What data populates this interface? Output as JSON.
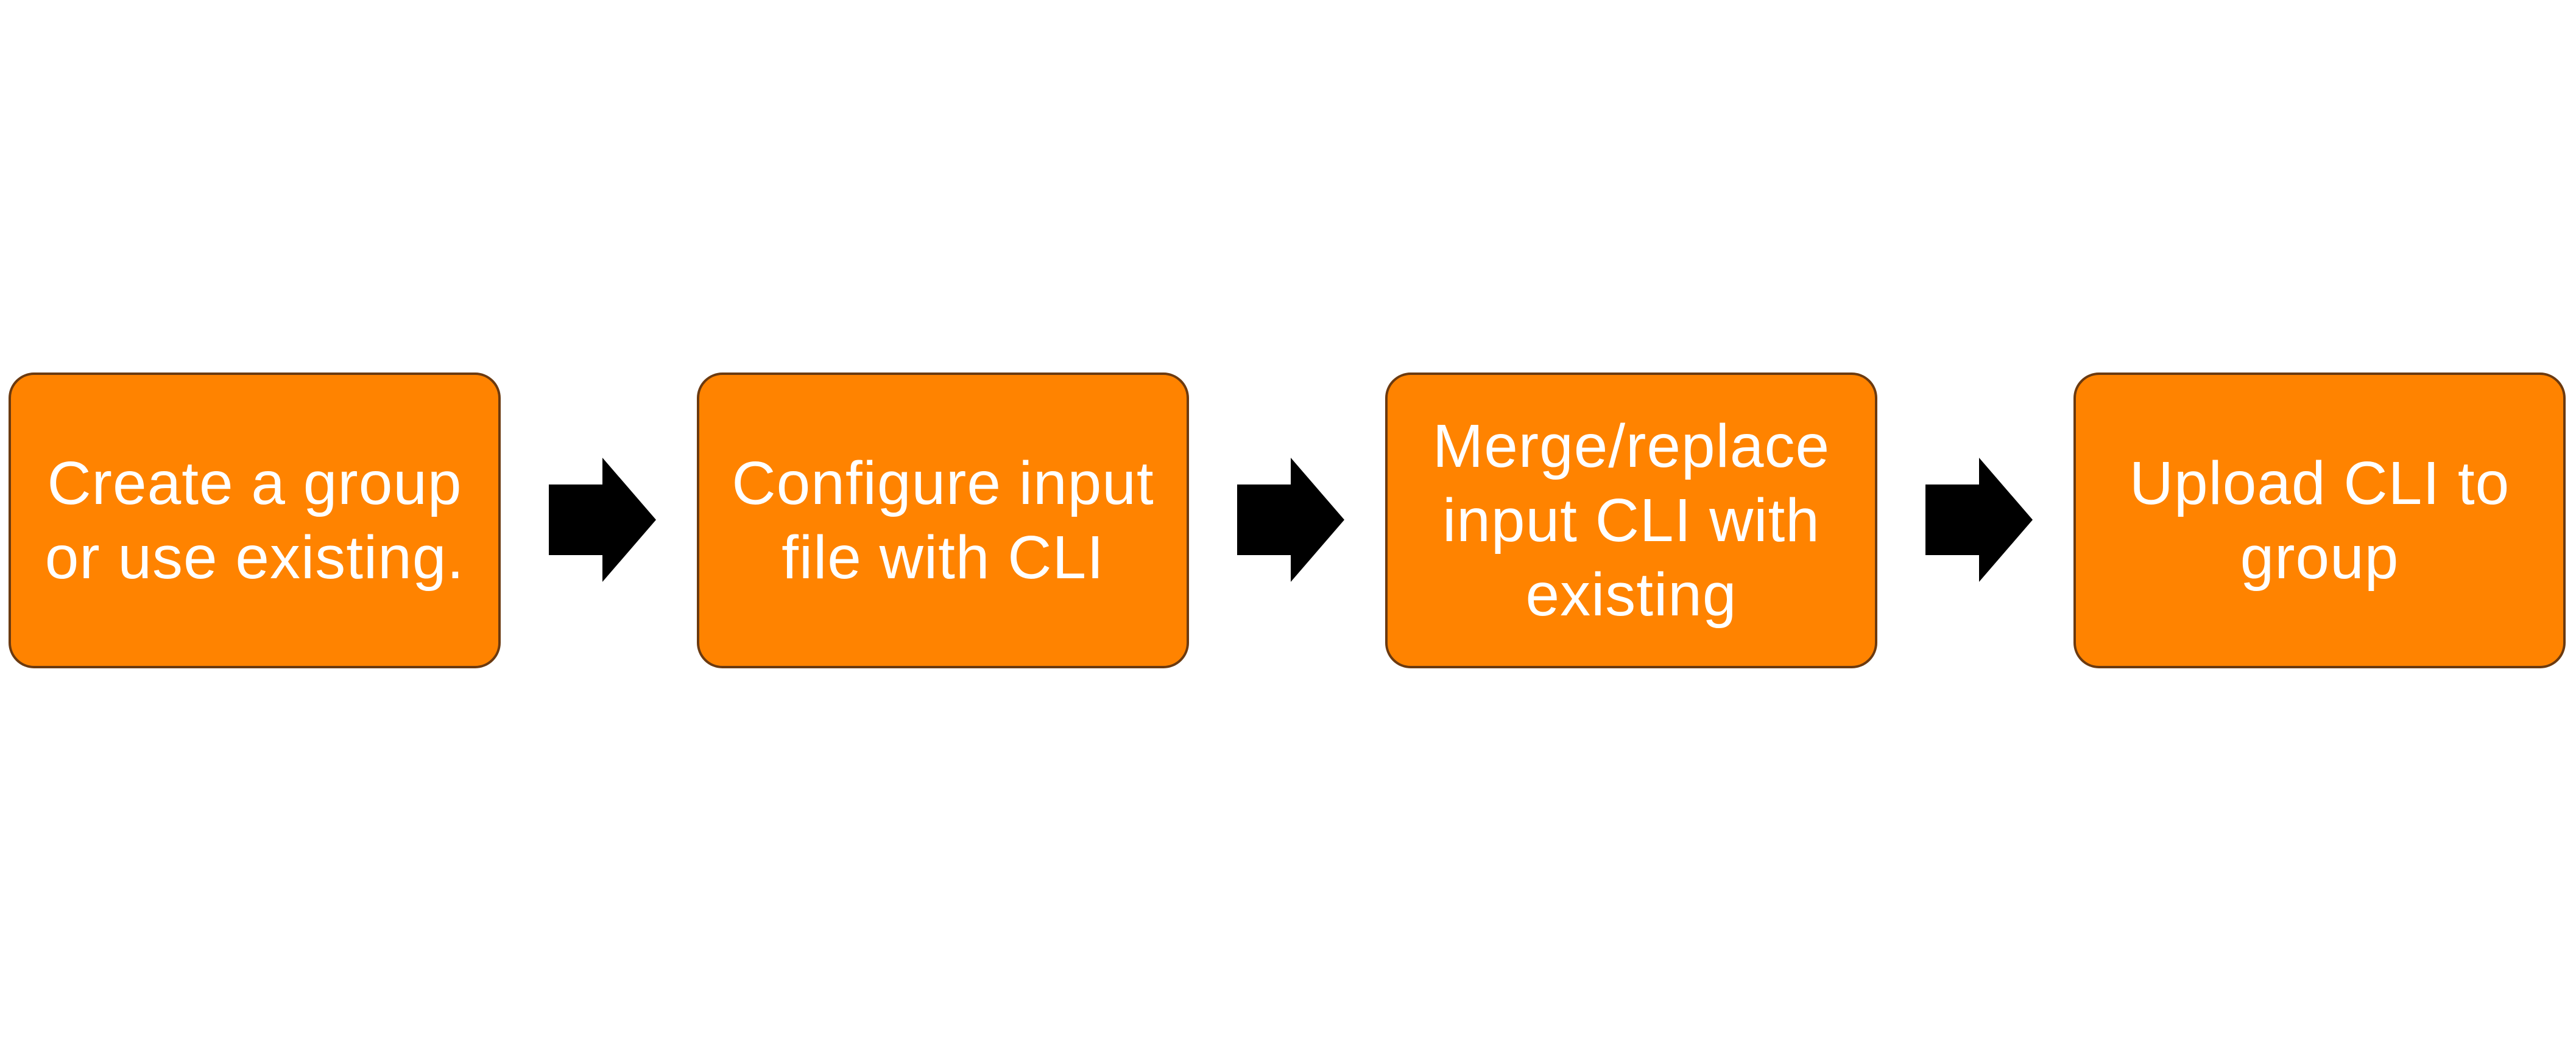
{
  "diagram": {
    "steps": [
      {
        "label": "Create a group or use existing."
      },
      {
        "label": "Configure input file with CLI"
      },
      {
        "label": "Merge/replace input CLI with existing"
      },
      {
        "label": "Upload CLI to group"
      }
    ],
    "connector_icon": "right-arrow-icon",
    "colors": {
      "box_fill": "#ff8300",
      "box_border": "#6b3a10",
      "text": "#ffffff",
      "arrow": "#000000"
    }
  }
}
